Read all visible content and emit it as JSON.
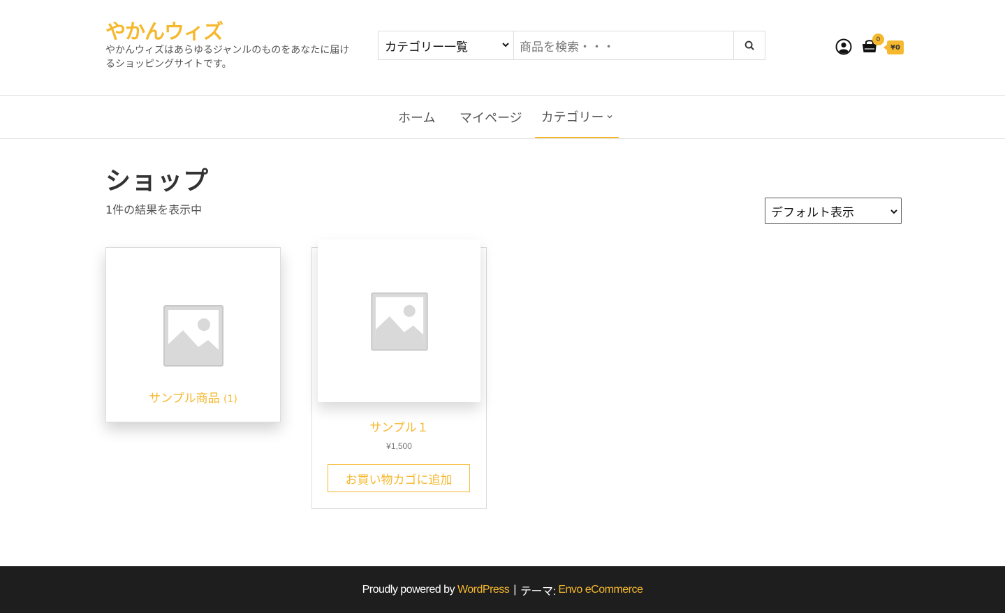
{
  "brand": {
    "title": "やかんウィズ",
    "description": "やかんウィズはあらゆるジャンルのものをあなたに届けるショッピングサイトです。"
  },
  "search": {
    "category_selected": "カテゴリー一覧",
    "placeholder": "商品を検索・・・"
  },
  "cart": {
    "count": "0",
    "total": "¥0"
  },
  "nav": {
    "items": [
      {
        "label": "ホーム"
      },
      {
        "label": "マイページ"
      },
      {
        "label": "カテゴリー"
      }
    ]
  },
  "main": {
    "title": "ショップ",
    "result_count": "1件の結果を表示中",
    "sort_selected": "デフォルト表示"
  },
  "category_card": {
    "name": "サンプル商品",
    "count": "(1)"
  },
  "product_card": {
    "name": "サンプル１",
    "price": "¥1,500",
    "add_to_cart": "お買い物カゴに追加"
  },
  "footer": {
    "prefix": "Proudly powered by",
    "wordpress": "WordPress",
    "separator": "|",
    "theme_label": "テーマ:",
    "theme_name": "Envo eCommerce"
  },
  "colors": {
    "accent": "#f5b82e",
    "footer_bg": "#1e1e1e"
  }
}
